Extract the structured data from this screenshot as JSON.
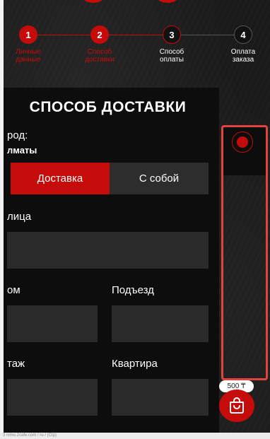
{
  "steps": [
    {
      "number": "1",
      "label_line1": "Личные",
      "label_line2": "данные",
      "state": "done"
    },
    {
      "number": "2",
      "label_line1": "Способ",
      "label_line2": "доставки",
      "state": "current"
    },
    {
      "number": "3",
      "label_line1": "Способ",
      "label_line2": "оплаты",
      "state": "next"
    },
    {
      "number": "4",
      "label_line1": "Оплата",
      "label_line2": "заказа",
      "state": "pending"
    }
  ],
  "form": {
    "title": "СПОСОБ ДОСТАВКИ",
    "city_label": "род:",
    "city_value": "лматы",
    "delivery_toggle": {
      "delivery": "Доставка",
      "pickup": "С собой",
      "selected": "delivery"
    },
    "street_label": "лица",
    "street_value": "",
    "house_label": "ом",
    "house_value": "",
    "entrance_label": "Подъезд",
    "entrance_value": "",
    "floor_label": "таж",
    "floor_value": "",
    "apartment_label": "Квартира",
    "apartment_value": ""
  },
  "cart": {
    "total": "500 ₸"
  },
  "footer": {
    "url_text": "3 nimo.2cafe.com / ru / (Ctp)"
  },
  "colors": {
    "accent": "#c60b0b",
    "highlight_frame": "#e0443e",
    "card": "#0d0d0d",
    "field": "#2a2a2a"
  },
  "icons": {
    "cart": "shopping-bag-icon",
    "radio": "radio-selected-icon"
  }
}
